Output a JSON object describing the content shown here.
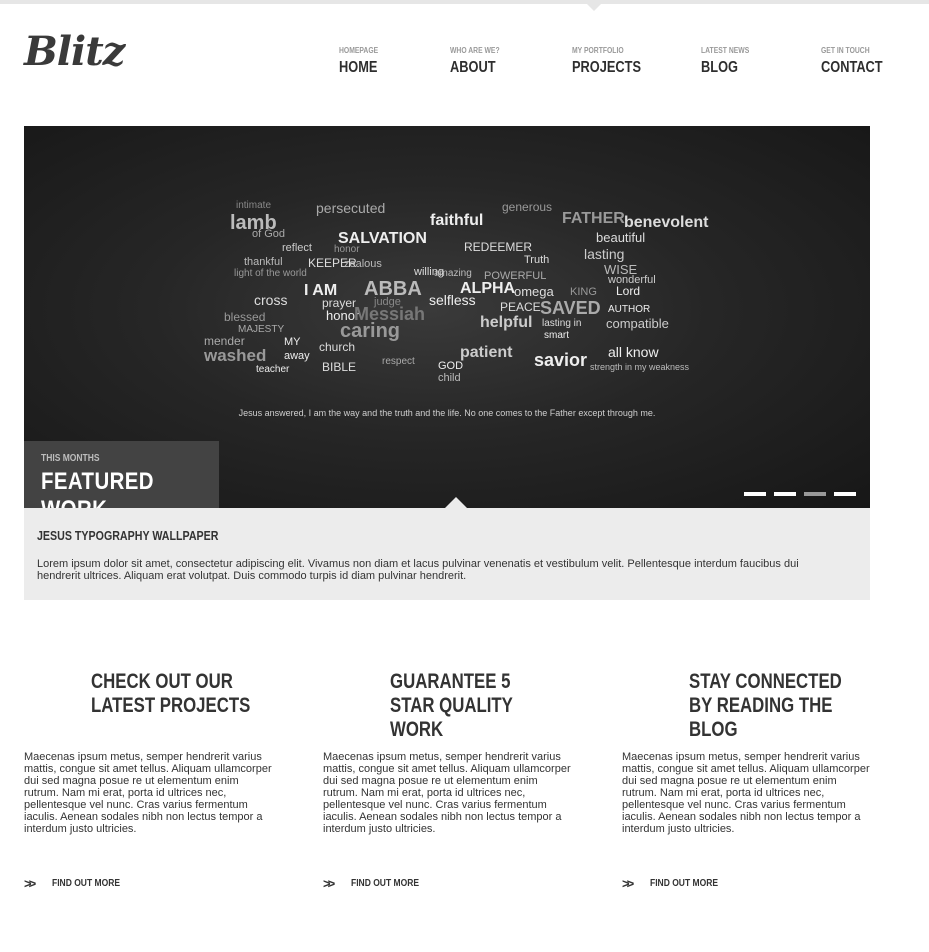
{
  "brand": {
    "logo_text": "Blitz"
  },
  "nav": {
    "items": [
      {
        "sub": "HOMEPAGE",
        "label": "HOME"
      },
      {
        "sub": "WHO ARE WE?",
        "label": "ABOUT"
      },
      {
        "sub": "MY PORTFOLIO",
        "label": "PROJECTS"
      },
      {
        "sub": "LATEST NEWS",
        "label": "BLOG"
      },
      {
        "sub": "GET IN TOUCH",
        "label": "CONTACT"
      }
    ]
  },
  "slider": {
    "quote": "Jesus answered,   I am the way and the truth and the life. No one comes to the Father except through me.",
    "featured_kicker": "THIS MONTHS",
    "featured_title": "FEATURED WORK",
    "active_slide": 3,
    "slide_count": 4,
    "words": [
      "intimate",
      "persecuted",
      "generous",
      "lamb",
      "faithful",
      "FATHER",
      "benevolent",
      "of God",
      "SALVATION",
      "beautiful",
      "reflect",
      "honor",
      "REDEEMER",
      "lasting",
      "thankful",
      "KEEPER",
      "zealous",
      "Truth",
      "WISE",
      "light of the world",
      "willing",
      "amazing",
      "POWERFUL",
      "wonderful",
      "I AM",
      "ABBA",
      "ALPHA",
      "omega",
      "KING",
      "Lord",
      "cross",
      "prayer",
      "judge",
      "selfless",
      "PEACE",
      "SAVED",
      "AUTHOR",
      "blessed",
      "honor",
      "Messiah",
      "helpful",
      "lasting in",
      "compatible",
      "MAJESTY",
      "caring",
      "smart",
      "mender",
      "MY",
      "church",
      "patient",
      "savior",
      "all know",
      "washed",
      "away",
      "teacher",
      "BIBLE",
      "respect",
      "GOD",
      "child",
      "strength in my weakness"
    ]
  },
  "caption": {
    "title": "JESUS TYPOGRAPHY WALLPAPER",
    "text": "Lorem ipsum dolor sit amet, consectetur adipiscing elit. Vivamus non diam et lacus pulvinar venenatis et vestibulum velit. Pellentesque interdum faucibus dui hendrerit ultrices. Aliquam erat volutpat. Duis commodo turpis id diam pulvinar hendrerit."
  },
  "columns": [
    {
      "title": "CHECK OUT OUR LATEST PROJECTS",
      "text": "Maecenas ipsum metus, semper hendrerit varius mattis, congue sit amet tellus. Aliquam ullamcorper dui sed magna posue re ut elementum enim rutrum. Nam mi erat, porta id ultrices nec, pellentesque vel nunc. Cras varius fermentum iaculis. Aenean sodales nibh non lectus tempor a interdum justo ultricies.",
      "link": "FIND OUT MORE"
    },
    {
      "title": "GUARANTEE 5 STAR QUALITY WORK",
      "text": "Maecenas ipsum metus, semper hendrerit varius mattis, congue sit amet tellus. Aliquam ullamcorper dui sed magna posue re ut elementum enim rutrum. Nam mi erat, porta id ultrices nec, pellentesque vel nunc. Cras varius fermentum iaculis. Aenean sodales nibh non lectus tempor a interdum justo ultricies.",
      "link": "FIND OUT MORE"
    },
    {
      "title": "STAY CONNECTED BY READING THE BLOG",
      "text": "Maecenas ipsum metus, semper hendrerit varius mattis, congue sit amet tellus. Aliquam ullamcorper dui sed magna posue re ut elementum enim rutrum. Nam mi erat, porta id ultrices nec, pellentesque vel nunc. Cras varius fermentum iaculis. Aenean sodales nibh non lectus tempor a interdum justo ultricies.",
      "link": "FIND OUT MORE"
    }
  ],
  "icons": {
    "link_arrow": "double-chevron-right-icon"
  },
  "colors": {
    "text": "#333333",
    "caption_bg": "#ececec",
    "slider_bg": "#1c1c1c",
    "featured_bg": "#464646"
  }
}
